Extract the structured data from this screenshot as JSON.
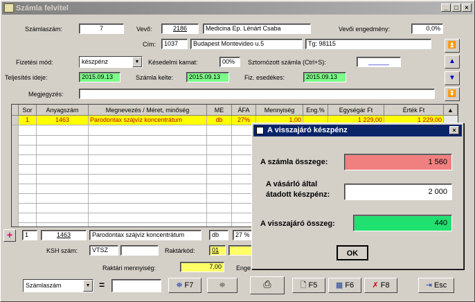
{
  "window": {
    "title": "Számla felvitel"
  },
  "header": {
    "szamlaszam_label": "Számlaszám:",
    "szamlaszam": "7",
    "vevo_label": "Vevő:",
    "vevo_kod": "2186",
    "vevo_nev": "Medicina Ep. Lénárt Csaba",
    "engedmeny_label": "Vevői engedmény:",
    "engedmeny": "0,0%",
    "cim_label": "Cím:",
    "irsz": "1037",
    "cim": "Budapest Montevideo u.5",
    "tel": "Tg: 98115",
    "fizmod_label": "Fizetési mód:",
    "fizmod": "készpénz",
    "kamat_label": "Késedelmi kamat:",
    "kamat": "00%",
    "sztorno_label": "Sztornózott számla (Ctrl+S):",
    "sztorno": "______",
    "teljesites_label": "Teljesítés ideje:",
    "teljesites": "2015.09.13",
    "kelte_label": "Számla kelte:",
    "kelte": "2015.09.13",
    "esedekes_label": "Fiz. esedékes:",
    "esedekes": "2015.09.13",
    "megjegyzes_label": "Megjegyzés:",
    "megjegyzes": ""
  },
  "grid": {
    "columns": [
      "Sor",
      "Anyagszám",
      "Megnevezés / Méret, minőség",
      "ME",
      "ÁFA",
      "Mennyiség",
      "Eng.%",
      "Egységár Ft",
      "Érték Ft"
    ],
    "rows": [
      [
        "1",
        "1463",
        "Parodontax szájvíz koncentrátum",
        "db",
        "27%",
        "1,00",
        "",
        "1 229,00",
        "1 229,00"
      ]
    ]
  },
  "editrow": {
    "sor": "1",
    "anyagszam": "1463",
    "megnevezes": "Parodontax szájvíz koncentrátum",
    "me": "db",
    "afa": "27 %"
  },
  "bottom": {
    "ksh_label": "KSH szám:",
    "ksh": "VTSZ",
    "ksh2": "",
    "raktarkod_label": "Raktárkód:",
    "raktarkod": "01",
    "raktari_label": "Raktári mennyiség:",
    "raktari": "7,00",
    "enge_label": "Enge",
    "search_mode": "Számlaszám",
    "eq": "=",
    "search_value": "",
    "f7": "F7",
    "f5": "F5",
    "f6": "F6",
    "f8": "F8",
    "esc": "Esc"
  },
  "dialog": {
    "title": "A visszajáró készpénz",
    "osszeg_label": "A számla összege:",
    "osszeg": "1 560",
    "atadott_label1": "A vásárló által",
    "atadott_label2": "átadott készpénz:",
    "atadott": "2 000",
    "vissza_label": "A visszajáró összeg:",
    "vissza": "440",
    "ok": "OK"
  },
  "colors": {
    "green": "#7cfc88",
    "yellow": "#ffff66",
    "red_box": "#f08080",
    "title_blue": "#0a246a"
  }
}
